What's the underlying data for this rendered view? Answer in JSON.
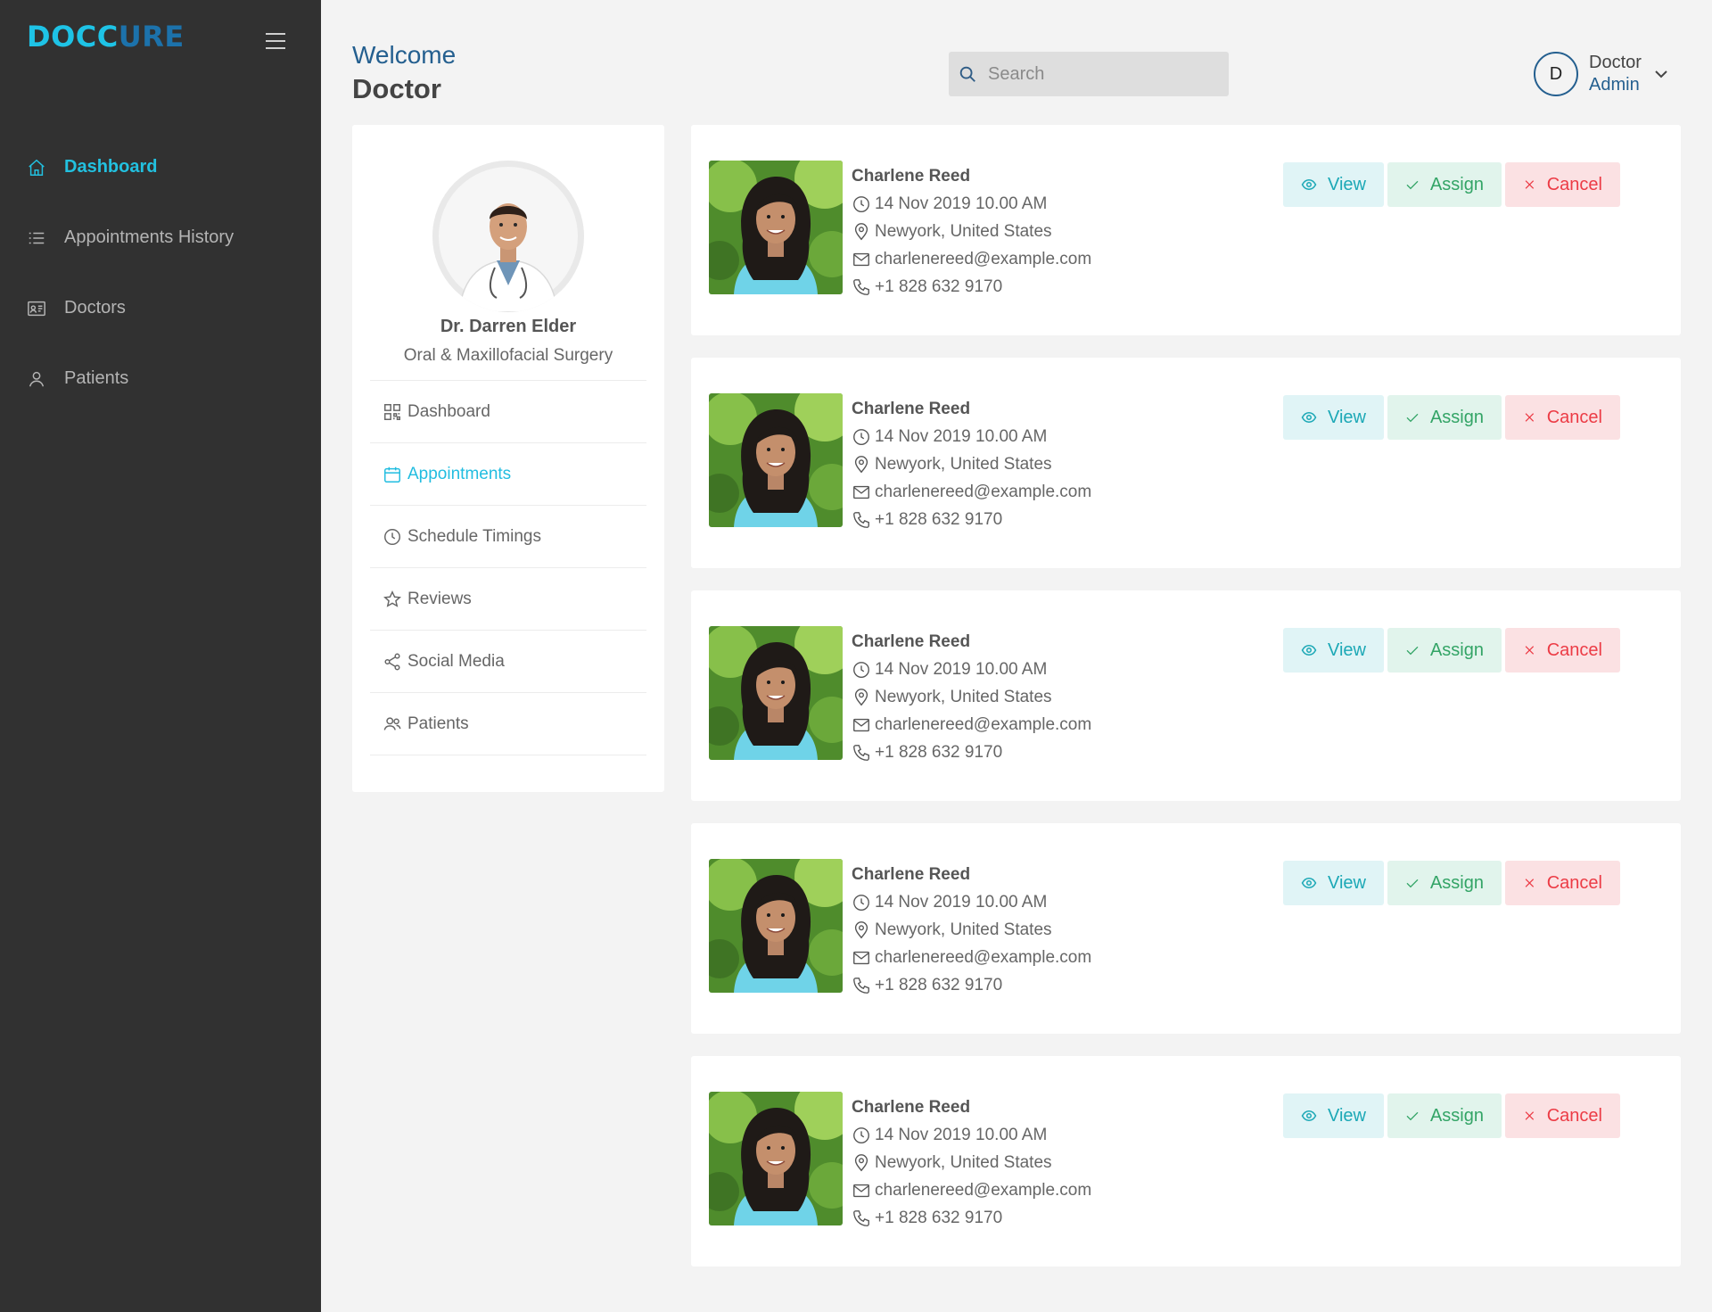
{
  "brand": {
    "logo_main": "DOCC",
    "logo_accent": "URE"
  },
  "sidebar": {
    "items": [
      {
        "label": "Dashboard",
        "icon": "home-icon",
        "active": true
      },
      {
        "label": "Appointments History",
        "icon": "list-icon",
        "active": false
      },
      {
        "label": "Doctors",
        "icon": "id-card-icon",
        "active": false
      },
      {
        "label": "Patients",
        "icon": "user-icon",
        "active": false
      }
    ]
  },
  "header": {
    "welcome": "Welcome",
    "role": "Doctor",
    "search_placeholder": "Search",
    "user": {
      "initial": "D",
      "line1": "Doctor",
      "line2": "Admin"
    }
  },
  "doctor": {
    "name": "Dr. Darren Elder",
    "specialty": "Oral & Maxillofacial Surgery",
    "menu": [
      {
        "label": "Dashboard",
        "icon": "grid-icon",
        "active": false
      },
      {
        "label": "Appointments",
        "icon": "calendar-icon",
        "active": true
      },
      {
        "label": "Schedule Timings",
        "icon": "clock-icon",
        "active": false
      },
      {
        "label": "Reviews",
        "icon": "star-icon",
        "active": false
      },
      {
        "label": "Social Media",
        "icon": "share-icon",
        "active": false
      },
      {
        "label": "Patients",
        "icon": "users-icon",
        "active": false
      }
    ]
  },
  "appointments": [
    {
      "name": "Charlene Reed",
      "datetime": "14 Nov 2019 10.00 AM",
      "location": "Newyork, United States",
      "email": "charlenereed@example.com",
      "phone": "+1 828 632 9170"
    },
    {
      "name": "Charlene Reed",
      "datetime": "14 Nov 2019 10.00 AM",
      "location": "Newyork, United States",
      "email": "charlenereed@example.com",
      "phone": "+1 828 632 9170"
    },
    {
      "name": "Charlene Reed",
      "datetime": "14 Nov 2019 10.00 AM",
      "location": "Newyork, United States",
      "email": "charlenereed@example.com",
      "phone": "+1 828 632 9170"
    },
    {
      "name": "Charlene Reed",
      "datetime": "14 Nov 2019 10.00 AM",
      "location": "Newyork, United States",
      "email": "charlenereed@example.com",
      "phone": "+1 828 632 9170"
    },
    {
      "name": "Charlene Reed",
      "datetime": "14 Nov 2019 10.00 AM",
      "location": "Newyork, United States",
      "email": "charlenereed@example.com",
      "phone": "+1 828 632 9170"
    }
  ],
  "actions": {
    "view": "View",
    "assign": "Assign",
    "cancel": "Cancel"
  },
  "colors": {
    "sidebar_bg": "#313131",
    "accent": "#22c1e0",
    "brand_dark": "#245f8f",
    "view": "#1ca8b6",
    "assign": "#33a466",
    "cancel": "#ec3b45"
  }
}
